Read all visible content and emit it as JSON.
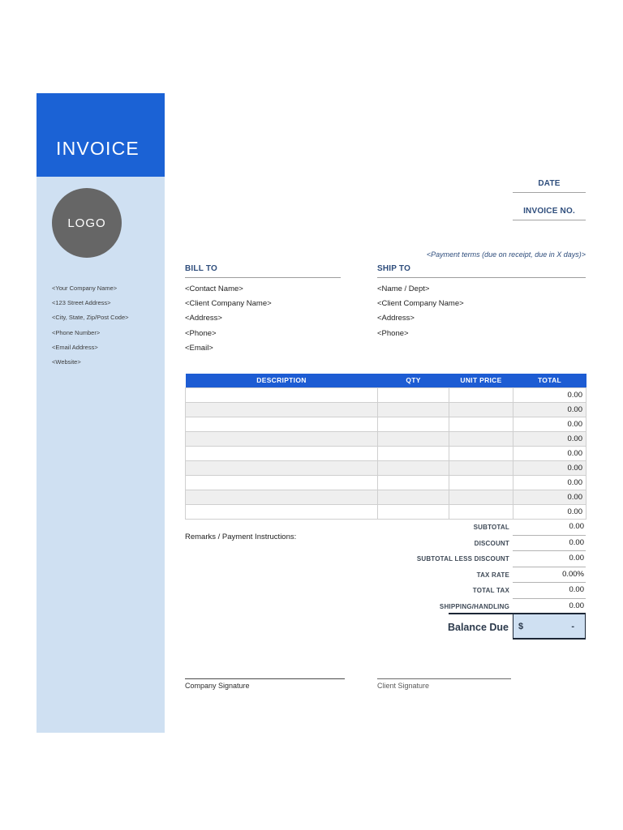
{
  "colors": {
    "hero_blue": "#1b62d5",
    "table_header_blue": "#1d5cd3",
    "sidebar_light_blue": "#cfe0f2",
    "logo_gray": "#666666",
    "navy_label": "#2e4d7c",
    "balance_rule_dark": "#1c2736",
    "alt_row_gray": "#efefef"
  },
  "sidebar": {
    "title": "INVOICE",
    "logo_text": "LOGO",
    "items": [
      "<Your Company Name>",
      "<123 Street Address>",
      "<City, State, Zip/Post Code>",
      "<Phone Number>",
      "<Email Address>",
      "<Website>"
    ]
  },
  "meta": {
    "date_label": "DATE",
    "invoice_no_label": "INVOICE NO.",
    "payment_terms": "<Payment terms (due on receipt, due in X days)>"
  },
  "bill_to": {
    "label": "BILL TO",
    "lines": [
      "<Contact Name>",
      "<Client Company Name>",
      "<Address>",
      "<Phone>",
      "<Email>"
    ]
  },
  "ship_to": {
    "label": "SHIP TO",
    "lines": [
      "<Name / Dept>",
      "<Client Company Name>",
      "<Address>",
      "<Phone>"
    ]
  },
  "items_table": {
    "headers": [
      "DESCRIPTION",
      "QTY",
      "UNIT PRICE",
      "TOTAL"
    ],
    "rows": [
      {
        "description": "",
        "qty": "",
        "unit_price": "",
        "total": "0.00"
      },
      {
        "description": "",
        "qty": "",
        "unit_price": "",
        "total": "0.00"
      },
      {
        "description": "",
        "qty": "",
        "unit_price": "",
        "total": "0.00"
      },
      {
        "description": "",
        "qty": "",
        "unit_price": "",
        "total": "0.00"
      },
      {
        "description": "",
        "qty": "",
        "unit_price": "",
        "total": "0.00"
      },
      {
        "description": "",
        "qty": "",
        "unit_price": "",
        "total": "0.00"
      },
      {
        "description": "",
        "qty": "",
        "unit_price": "",
        "total": "0.00"
      },
      {
        "description": "",
        "qty": "",
        "unit_price": "",
        "total": "0.00"
      },
      {
        "description": "",
        "qty": "",
        "unit_price": "",
        "total": "0.00"
      }
    ]
  },
  "remarks_label": "Remarks / Payment Instructions:",
  "summary": {
    "rows": [
      {
        "label": "SUBTOTAL",
        "value": "0.00"
      },
      {
        "label": "DISCOUNT",
        "value": "0.00"
      },
      {
        "label": "SUBTOTAL LESS DISCOUNT",
        "value": "0.00"
      },
      {
        "label": "TAX RATE",
        "value": "0.00%"
      },
      {
        "label": "TOTAL TAX",
        "value": "0.00"
      },
      {
        "label": "SHIPPING/HANDLING",
        "value": "0.00"
      }
    ],
    "balance_due_label": "Balance Due",
    "currency_symbol": "$",
    "balance_value": "-"
  },
  "signatures": {
    "company": "Company Signature",
    "client": "Client Signature"
  }
}
